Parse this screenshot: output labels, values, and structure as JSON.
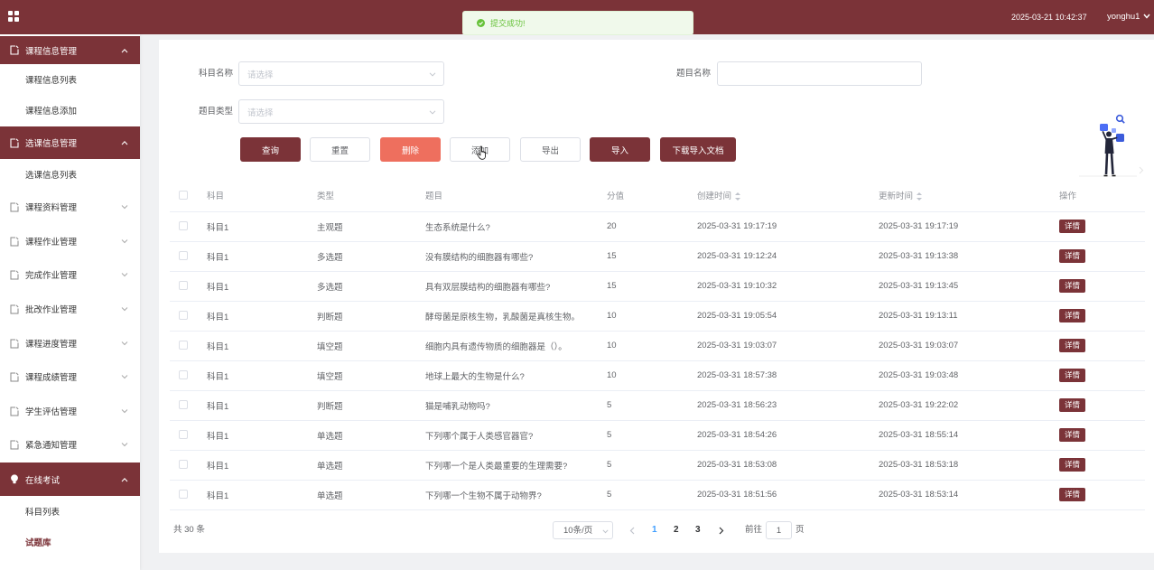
{
  "header": {
    "menu_icon": "grid-icon",
    "datetime": "2025-03-21 10:42:37",
    "username": "yonghu1",
    "user_menu_icon": "chevron-down-icon"
  },
  "toast": {
    "icon": "check-circle-icon",
    "message": "提交成功!"
  },
  "sidebar": {
    "groups": [
      {
        "label": "课程信息管理",
        "icon": "document-icon",
        "expanded": true,
        "items": [
          {
            "label": "课程信息列表"
          },
          {
            "label": "课程信息添加"
          }
        ]
      },
      {
        "label": "选课信息管理",
        "icon": "document-icon",
        "expanded": true,
        "items": [
          {
            "label": "选课信息列表"
          }
        ]
      },
      {
        "label": "课程资料管理",
        "icon": "document-icon",
        "expanded": false
      },
      {
        "label": "课程作业管理",
        "icon": "document-icon",
        "expanded": false
      },
      {
        "label": "完成作业管理",
        "icon": "document-icon",
        "expanded": false
      },
      {
        "label": "批改作业管理",
        "icon": "document-icon",
        "expanded": false
      },
      {
        "label": "课程进度管理",
        "icon": "document-icon",
        "expanded": false
      },
      {
        "label": "课程成绩管理",
        "icon": "document-icon",
        "expanded": false
      },
      {
        "label": "学生评估管理",
        "icon": "document-icon",
        "expanded": false
      },
      {
        "label": "紧急通知管理",
        "icon": "document-icon",
        "expanded": false
      },
      {
        "label": "在线考试",
        "icon": "bulb-icon",
        "expanded": true,
        "items": [
          {
            "label": "科目列表"
          },
          {
            "label": "试题库",
            "active": true
          }
        ]
      }
    ]
  },
  "search": {
    "subject": {
      "label": "科目名称",
      "placeholder": "请选择"
    },
    "title": {
      "label": "题目名称",
      "value": ""
    },
    "type": {
      "label": "题目类型",
      "placeholder": "请选择"
    }
  },
  "actions": {
    "query": "查询",
    "reset": "重置",
    "delete": "删除",
    "add": "添加",
    "export": "导出",
    "import": "导入",
    "download_template": "下载导入文档"
  },
  "table": {
    "columns": [
      "科目",
      "类型",
      "题目",
      "分值",
      "创建时间",
      "更新时间",
      "操作"
    ],
    "rows": [
      {
        "subject": "科目1",
        "type": "主观题",
        "question": "生态系统是什么?",
        "score": 20,
        "created": "2025-03-31 19:17:19",
        "updated": "2025-03-31 19:17:19",
        "action": "详情"
      },
      {
        "subject": "科目1",
        "type": "多选题",
        "question": "没有膜结构的细胞器有哪些?",
        "score": 15,
        "created": "2025-03-31 19:12:24",
        "updated": "2025-03-31 19:13:38",
        "action": "详情"
      },
      {
        "subject": "科目1",
        "type": "多选题",
        "question": "具有双层膜结构的细胞器有哪些?",
        "score": 15,
        "created": "2025-03-31 19:10:32",
        "updated": "2025-03-31 19:13:45",
        "action": "详情"
      },
      {
        "subject": "科目1",
        "type": "判断题",
        "question": "酵母菌是原核生物，乳酸菌是真核生物。",
        "score": 10,
        "created": "2025-03-31 19:05:54",
        "updated": "2025-03-31 19:13:11",
        "action": "详情"
      },
      {
        "subject": "科目1",
        "type": "填空题",
        "question": "细胞内具有遗传物质的细胞器是（）。",
        "score": 10,
        "created": "2025-03-31 19:03:07",
        "updated": "2025-03-31 19:03:07",
        "action": "详情"
      },
      {
        "subject": "科目1",
        "type": "填空题",
        "question": "地球上最大的生物是什么?",
        "score": 10,
        "created": "2025-03-31 18:57:38",
        "updated": "2025-03-31 19:03:48",
        "action": "详情"
      },
      {
        "subject": "科目1",
        "type": "判断题",
        "question": "猫是哺乳动物吗?",
        "score": 5,
        "created": "2025-03-31 18:56:23",
        "updated": "2025-03-31 19:22:02",
        "action": "详情"
      },
      {
        "subject": "科目1",
        "type": "单选题",
        "question": "下列哪个属于人类感官器官?",
        "score": 5,
        "created": "2025-03-31 18:54:26",
        "updated": "2025-03-31 18:55:14",
        "action": "详情"
      },
      {
        "subject": "科目1",
        "type": "单选题",
        "question": "下列哪一个是人类最重要的生理需要?",
        "score": 5,
        "created": "2025-03-31 18:53:08",
        "updated": "2025-03-31 18:53:18",
        "action": "详情"
      },
      {
        "subject": "科目1",
        "type": "单选题",
        "question": "下列哪一个生物不属于动物界?",
        "score": 5,
        "created": "2025-03-31 18:51:56",
        "updated": "2025-03-31 18:53:14",
        "action": "详情"
      }
    ]
  },
  "pagination": {
    "total_text": "共 30 条",
    "page_size": "10条/页",
    "pages": [
      "1",
      "2",
      "3"
    ],
    "current_page": 1,
    "goto_label": "前往",
    "goto_value": "1",
    "page_suffix": "页"
  },
  "colors": {
    "primary": "#7b3338",
    "danger": "#ee6f5e",
    "success": "#67c23a",
    "active_page": "#409eff"
  }
}
